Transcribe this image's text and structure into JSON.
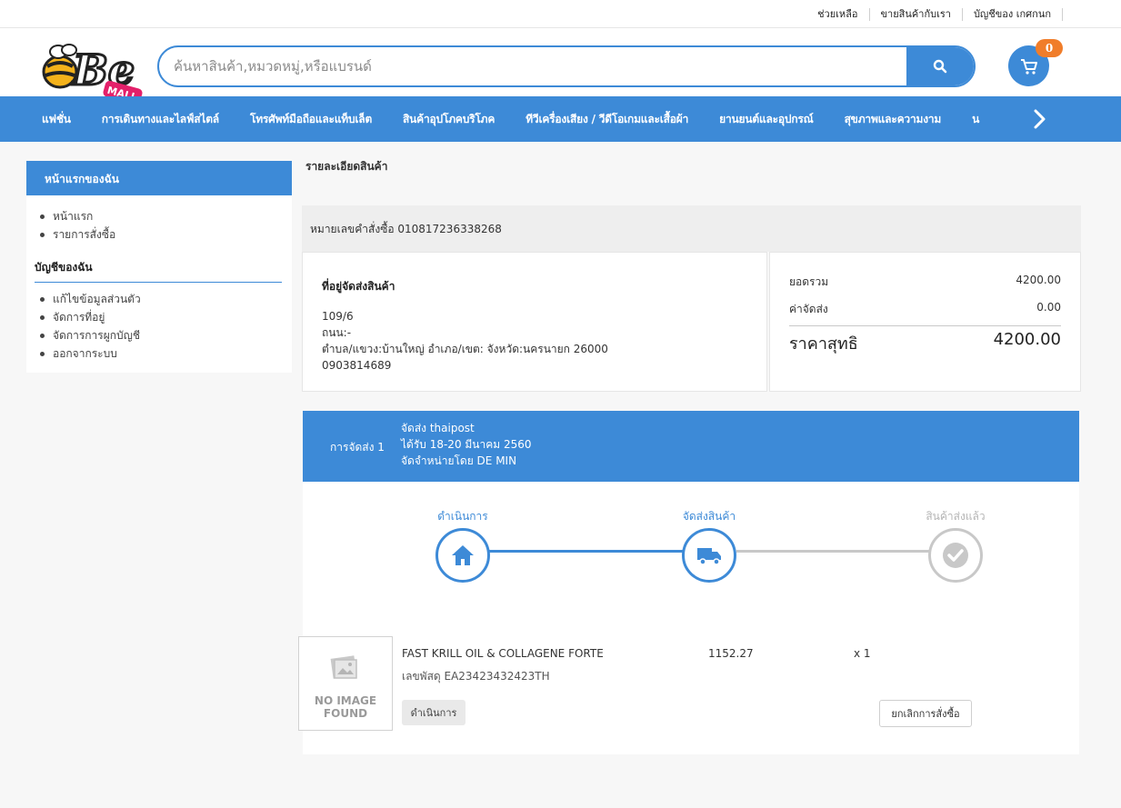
{
  "top_links": [
    "ช่วยเหลือ",
    "ขายสินค้ากับเรา",
    "บัญชีของ เกศกนก"
  ],
  "logo": {
    "text": "Be",
    "sub": "MALL",
    "icon": "bee-logo-icon"
  },
  "search": {
    "placeholder": "ค้นหาสินค้า,หมวดหมู่,หรือแบรนด์",
    "icon": "search-icon"
  },
  "cart": {
    "count": "0",
    "icon": "cart-icon"
  },
  "nav": {
    "items": [
      "แฟชั่น",
      "การเดินทางและไลฟ์สไตล์",
      "โทรศัพท์มือถือและแท็บเล็ต",
      "สินค้าอุปโภคบริโภค",
      "ทีวีเครื่องเสียง / วีดีโอเกมและเสื้อผ้า",
      "ยานยนต์และอุปกรณ์",
      "สุขภาพและความงาม",
      "น"
    ],
    "next_icon": "chevron-right-icon"
  },
  "sidebar": {
    "header": "หน้าแรกของฉัน",
    "items": [
      "หน้าแรก",
      "รายการสั่งซื้อ"
    ],
    "account_title": "บัญชีของฉัน",
    "account_items": [
      "แก้ไขข้อมูลส่วนตัว",
      "จัดการที่อยู่",
      "จัดการการผูกบัญชี",
      "ออกจากระบบ"
    ]
  },
  "page_title": "รายละเอียดสินค้า",
  "order": {
    "number_line": "หมายเลขคำสั่งซื้อ 010817236338268"
  },
  "address": {
    "title": "ที่อยู่จัดส่งสินค้า",
    "lines": [
      "109/6",
      "ถนน:-",
      "ตำบล/แขวง:บ้านใหญ่ อำเภอ/เขต: จังหวัด:นครนายก 26000",
      "0903814689"
    ]
  },
  "summary": {
    "subtotal_label": "ยอดรวม",
    "subtotal_value": "4200.00",
    "shipping_label": "ค่าจัดส่ง",
    "shipping_value": "0.00",
    "total_label": "ราคาสุทธิ",
    "total_value": "4200.00"
  },
  "shipment": {
    "label": "การจัดส่ง 1",
    "carrier": "จัดส่ง thaipost",
    "eta": "ได้รับ 18-20 มีนาคม 2560",
    "seller": "จัดจำหน่ายโดย DE MIN"
  },
  "tracking_steps": [
    {
      "label": "ดำเนินการ",
      "icon": "home-icon",
      "active": true
    },
    {
      "label": "จัดส่งสินค้า",
      "icon": "truck-icon",
      "active": true
    },
    {
      "label": "สินค้าส่งแล้ว",
      "icon": "check-icon",
      "active": false
    }
  ],
  "colors": {
    "accent": "#3d8ad7",
    "badge": "#f07d2a",
    "inactive": "#c8c8c8"
  },
  "product": {
    "image_text_1": "NO IMAGE",
    "image_text_2": "FOUND",
    "name": "FAST KRILL OIL & COLLAGENE FORTE",
    "tracking": "เลขพัสดุ EA23423432423TH",
    "price": "1152.27",
    "qty": "x 1",
    "status": "ดำเนินการ",
    "cancel_label": "ยกเลิกการสั่งซื้อ"
  }
}
